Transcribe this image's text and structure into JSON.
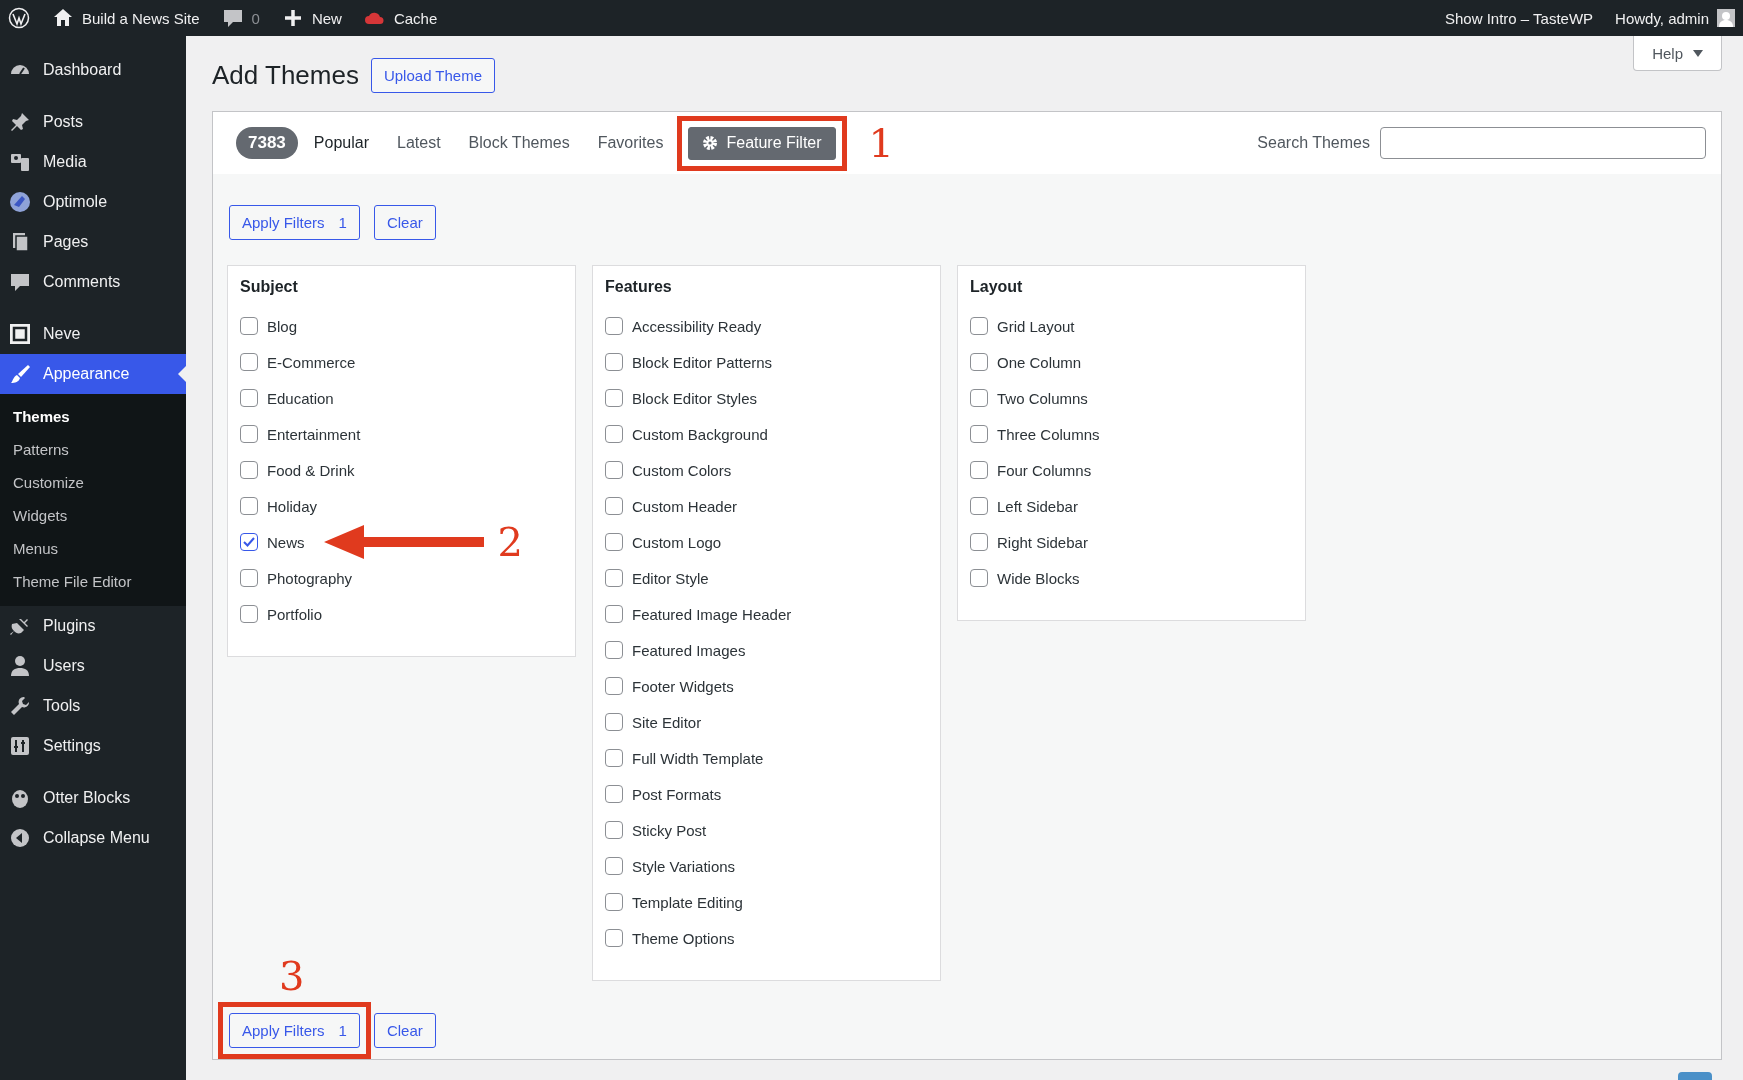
{
  "admin_bar": {
    "site": "Build a News Site",
    "comments": "0",
    "new": "New",
    "cache": "Cache",
    "intro": "Show Intro – TasteWP",
    "howdy": "Howdy, admin"
  },
  "sidebar": {
    "sections": [
      {
        "items": [
          {
            "label": "Dashboard",
            "kind": "gauge",
            "selected": false
          }
        ]
      },
      {
        "items": [
          {
            "label": "Posts",
            "kind": "pin",
            "selected": false
          },
          {
            "label": "Media",
            "kind": "media",
            "selected": false
          },
          {
            "label": "Optimole",
            "kind": "orb",
            "selected": false
          },
          {
            "label": "Pages",
            "kind": "pages",
            "selected": false
          },
          {
            "label": "Comments",
            "kind": "bubble",
            "selected": false
          }
        ]
      },
      {
        "items": [
          {
            "label": "Neve",
            "kind": "square",
            "selected": false
          },
          {
            "label": "Appearance",
            "kind": "brush",
            "selected": true,
            "submenu": [
              {
                "label": "Themes",
                "selected": true
              },
              {
                "label": "Patterns",
                "selected": false
              },
              {
                "label": "Customize",
                "selected": false
              },
              {
                "label": "Widgets",
                "selected": false
              },
              {
                "label": "Menus",
                "selected": false
              },
              {
                "label": "Theme File Editor",
                "selected": false
              }
            ]
          },
          {
            "label": "Plugins",
            "kind": "plug",
            "selected": false
          },
          {
            "label": "Users",
            "kind": "user",
            "selected": false
          },
          {
            "label": "Tools",
            "kind": "wrench",
            "selected": false
          },
          {
            "label": "Settings",
            "kind": "sliders",
            "selected": false
          }
        ]
      },
      {
        "items": [
          {
            "label": "Otter Blocks",
            "kind": "otter",
            "selected": false
          },
          {
            "label": "Collapse Menu",
            "kind": "collapse",
            "selected": false
          }
        ]
      }
    ]
  },
  "help": "Help",
  "page_title": "Add Themes",
  "upload_button": "Upload Theme",
  "filter_bar": {
    "count": "7383",
    "tabs": [
      {
        "label": "Popular",
        "selected": true
      },
      {
        "label": "Latest",
        "selected": false
      },
      {
        "label": "Block Themes",
        "selected": false
      },
      {
        "label": "Favorites",
        "selected": false
      }
    ],
    "feature_filter": {
      "label": "Feature Filter",
      "on": true,
      "highlighted": true,
      "annotation": "1"
    },
    "search_label": "Search Themes"
  },
  "actions_top": {
    "apply": "Apply Filters",
    "apply_count": "1",
    "clear": "Clear",
    "highlighted": false
  },
  "groups": [
    {
      "title": "Subject",
      "options": [
        {
          "label": "Blog",
          "checked": false
        },
        {
          "label": "E-Commerce",
          "checked": false
        },
        {
          "label": "Education",
          "checked": false
        },
        {
          "label": "Entertainment",
          "checked": false
        },
        {
          "label": "Food & Drink",
          "checked": false
        },
        {
          "label": "Holiday",
          "checked": false
        },
        {
          "label": "News",
          "checked": true,
          "annotation": "2"
        },
        {
          "label": "Photography",
          "checked": false
        },
        {
          "label": "Portfolio",
          "checked": false
        }
      ]
    },
    {
      "title": "Features",
      "options": [
        {
          "label": "Accessibility Ready",
          "checked": false
        },
        {
          "label": "Block Editor Patterns",
          "checked": false
        },
        {
          "label": "Block Editor Styles",
          "checked": false
        },
        {
          "label": "Custom Background",
          "checked": false
        },
        {
          "label": "Custom Colors",
          "checked": false
        },
        {
          "label": "Custom Header",
          "checked": false
        },
        {
          "label": "Custom Logo",
          "checked": false
        },
        {
          "label": "Editor Style",
          "checked": false
        },
        {
          "label": "Featured Image Header",
          "checked": false
        },
        {
          "label": "Featured Images",
          "checked": false
        },
        {
          "label": "Footer Widgets",
          "checked": false
        },
        {
          "label": "Site Editor",
          "checked": false
        },
        {
          "label": "Full Width Template",
          "checked": false
        },
        {
          "label": "Post Formats",
          "checked": false
        },
        {
          "label": "Sticky Post",
          "checked": false
        },
        {
          "label": "Style Variations",
          "checked": false
        },
        {
          "label": "Template Editing",
          "checked": false
        },
        {
          "label": "Theme Options",
          "checked": false
        }
      ]
    },
    {
      "title": "Layout",
      "options": [
        {
          "label": "Grid Layout",
          "checked": false
        },
        {
          "label": "One Column",
          "checked": false
        },
        {
          "label": "Two Columns",
          "checked": false
        },
        {
          "label": "Three Columns",
          "checked": false
        },
        {
          "label": "Four Columns",
          "checked": false
        },
        {
          "label": "Left Sidebar",
          "checked": false
        },
        {
          "label": "Right Sidebar",
          "checked": false
        },
        {
          "label": "Wide Blocks",
          "checked": false
        }
      ]
    }
  ],
  "actions_bottom": {
    "apply": "Apply Filters",
    "apply_count": "1",
    "clear": "Clear",
    "highlighted": true,
    "annotation": "3"
  }
}
